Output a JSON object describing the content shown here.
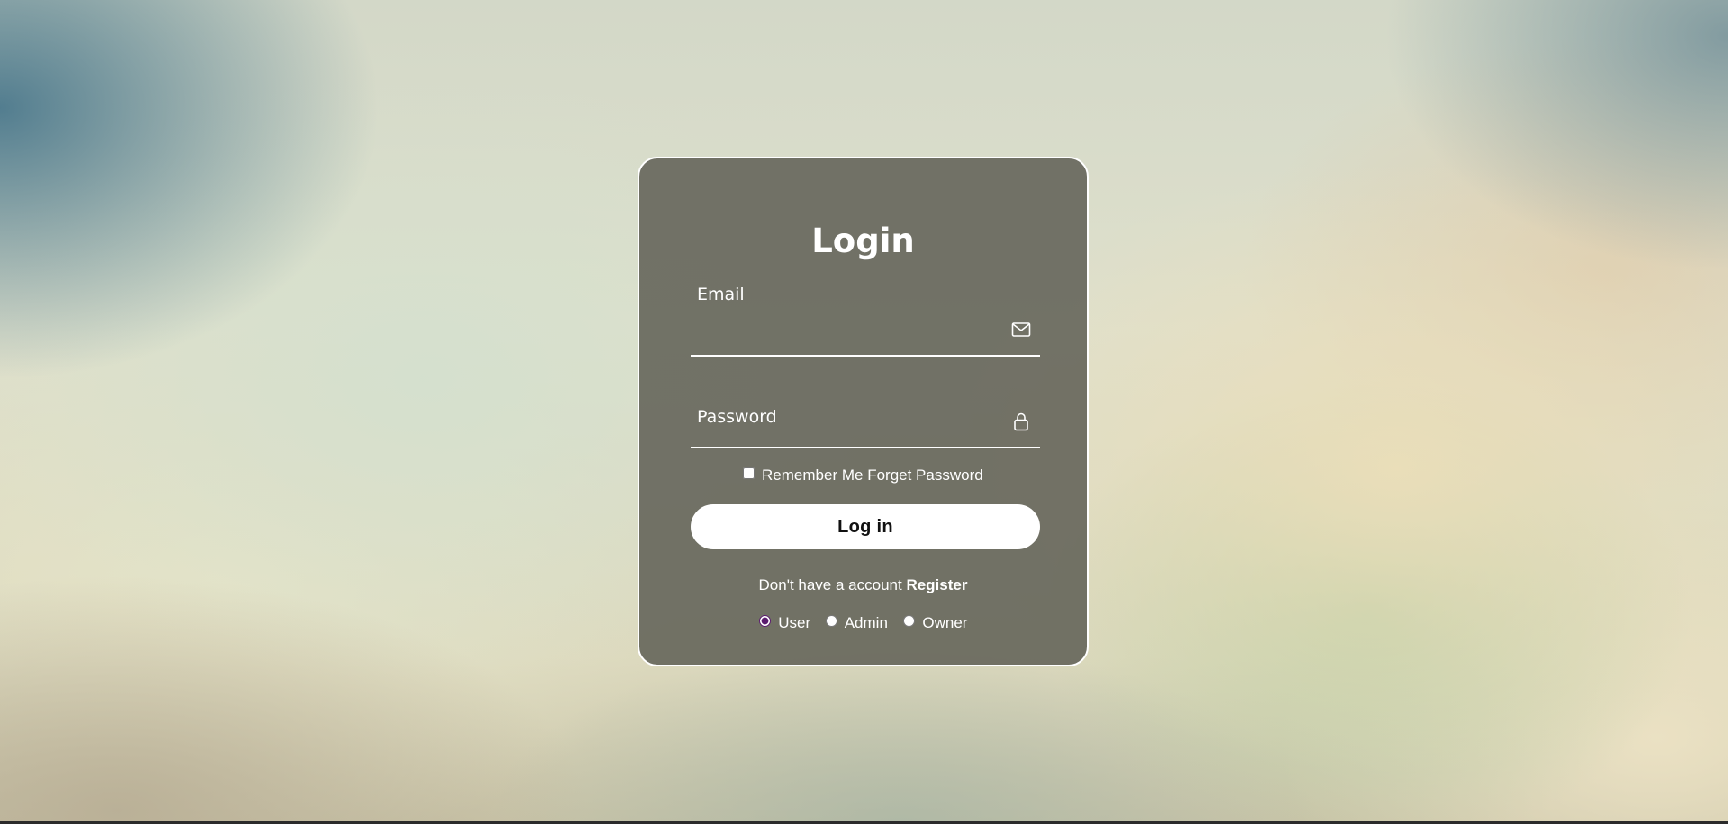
{
  "login": {
    "title": "Login",
    "email_label": "Email",
    "email_value": "",
    "password_label": "Password",
    "password_value": "",
    "remember_label": "Remember Me",
    "remember_checked": false,
    "forget_label": "Forget Password",
    "submit_label": "Log in",
    "register_prompt": "Don't have a account",
    "register_label": "Register",
    "roles": [
      {
        "label": "User",
        "checked": true
      },
      {
        "label": "Admin",
        "checked": false
      },
      {
        "label": "Owner",
        "checked": false
      }
    ]
  },
  "icons": {
    "email": "envelope-icon",
    "password": "lock-icon"
  },
  "colors": {
    "card_background": "#626258",
    "card_border": "#ffffff",
    "text": "#ffffff",
    "button_background": "#ffffff",
    "button_text": "#111111",
    "radio_accent": "#5a1a6e"
  }
}
